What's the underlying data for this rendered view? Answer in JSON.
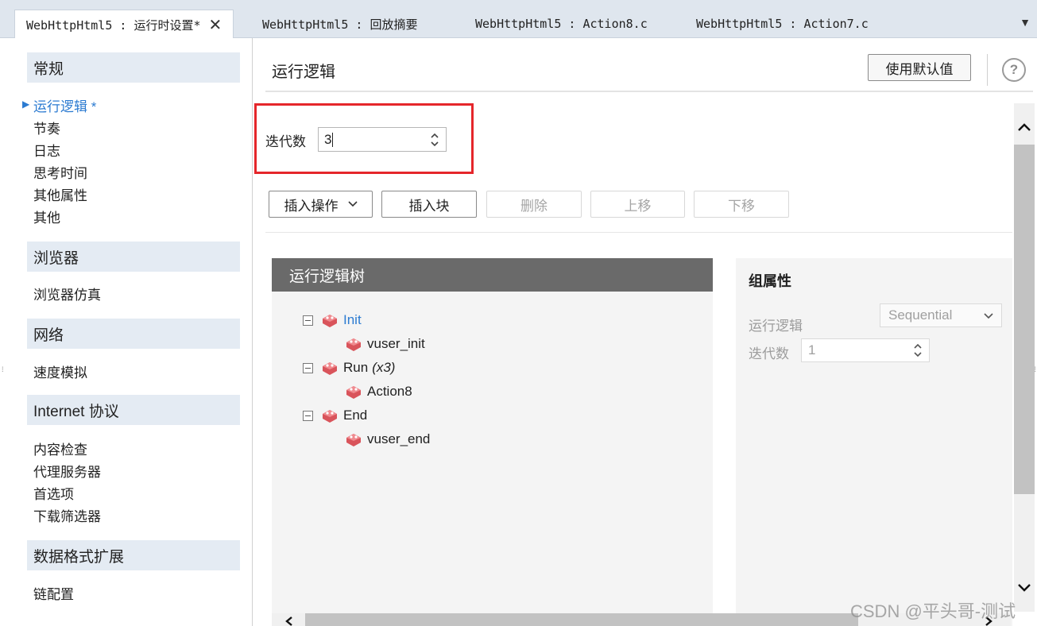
{
  "tabs": [
    {
      "label": "WebHttpHtml5 : 运行时设置*",
      "active": true
    },
    {
      "label": "WebHttpHtml5 : 回放摘要",
      "active": false
    },
    {
      "label": "WebHttpHtml5 : Action8.c",
      "active": false
    },
    {
      "label": "WebHttpHtml5 : Action7.c",
      "active": false
    }
  ],
  "tab_close": "✕",
  "tab_menu": "▼",
  "sidebar": {
    "sections": [
      {
        "label": "常规",
        "items": [
          "运行逻辑 *",
          "节奏",
          "日志",
          "思考时间",
          "其他属性",
          "其他"
        ]
      },
      {
        "label": "浏览器",
        "items": [
          "浏览器仿真"
        ]
      },
      {
        "label": "网络",
        "items": [
          "速度模拟"
        ]
      },
      {
        "label": "Internet 协议",
        "items": [
          "内容检查",
          "代理服务器",
          "首选项",
          "下载筛选器"
        ]
      },
      {
        "label": "数据格式扩展",
        "items": [
          "链配置"
        ]
      }
    ],
    "active_item": "运行逻辑 *"
  },
  "main": {
    "title": "运行逻辑",
    "default_button": "使用默认值",
    "help": "?",
    "iterations_label": "迭代数",
    "iterations_value": "3",
    "toolbar": {
      "insert_action": "插入操作",
      "insert_block": "插入块",
      "delete": "删除",
      "move_up": "上移",
      "move_down": "下移"
    }
  },
  "tree": {
    "header": "运行逻辑树",
    "nodes": [
      {
        "label": "Init",
        "suffix": "",
        "children": [
          "vuser_init"
        ]
      },
      {
        "label": "Run",
        "suffix": "(x3)",
        "children": [
          "Action8"
        ]
      },
      {
        "label": "End",
        "suffix": "",
        "children": [
          "vuser_end"
        ]
      }
    ]
  },
  "properties": {
    "title": "组属性",
    "logic_label": "运行逻辑",
    "logic_value": "Sequential",
    "iter_label": "迭代数",
    "iter_value": "1"
  },
  "colors": {
    "accent": "#2c7bd1",
    "highlight_border": "#e5262b",
    "tree_header": "#6a6a6a",
    "block_icon": "#d9545b"
  },
  "watermark": "CSDN @平头哥-测试"
}
